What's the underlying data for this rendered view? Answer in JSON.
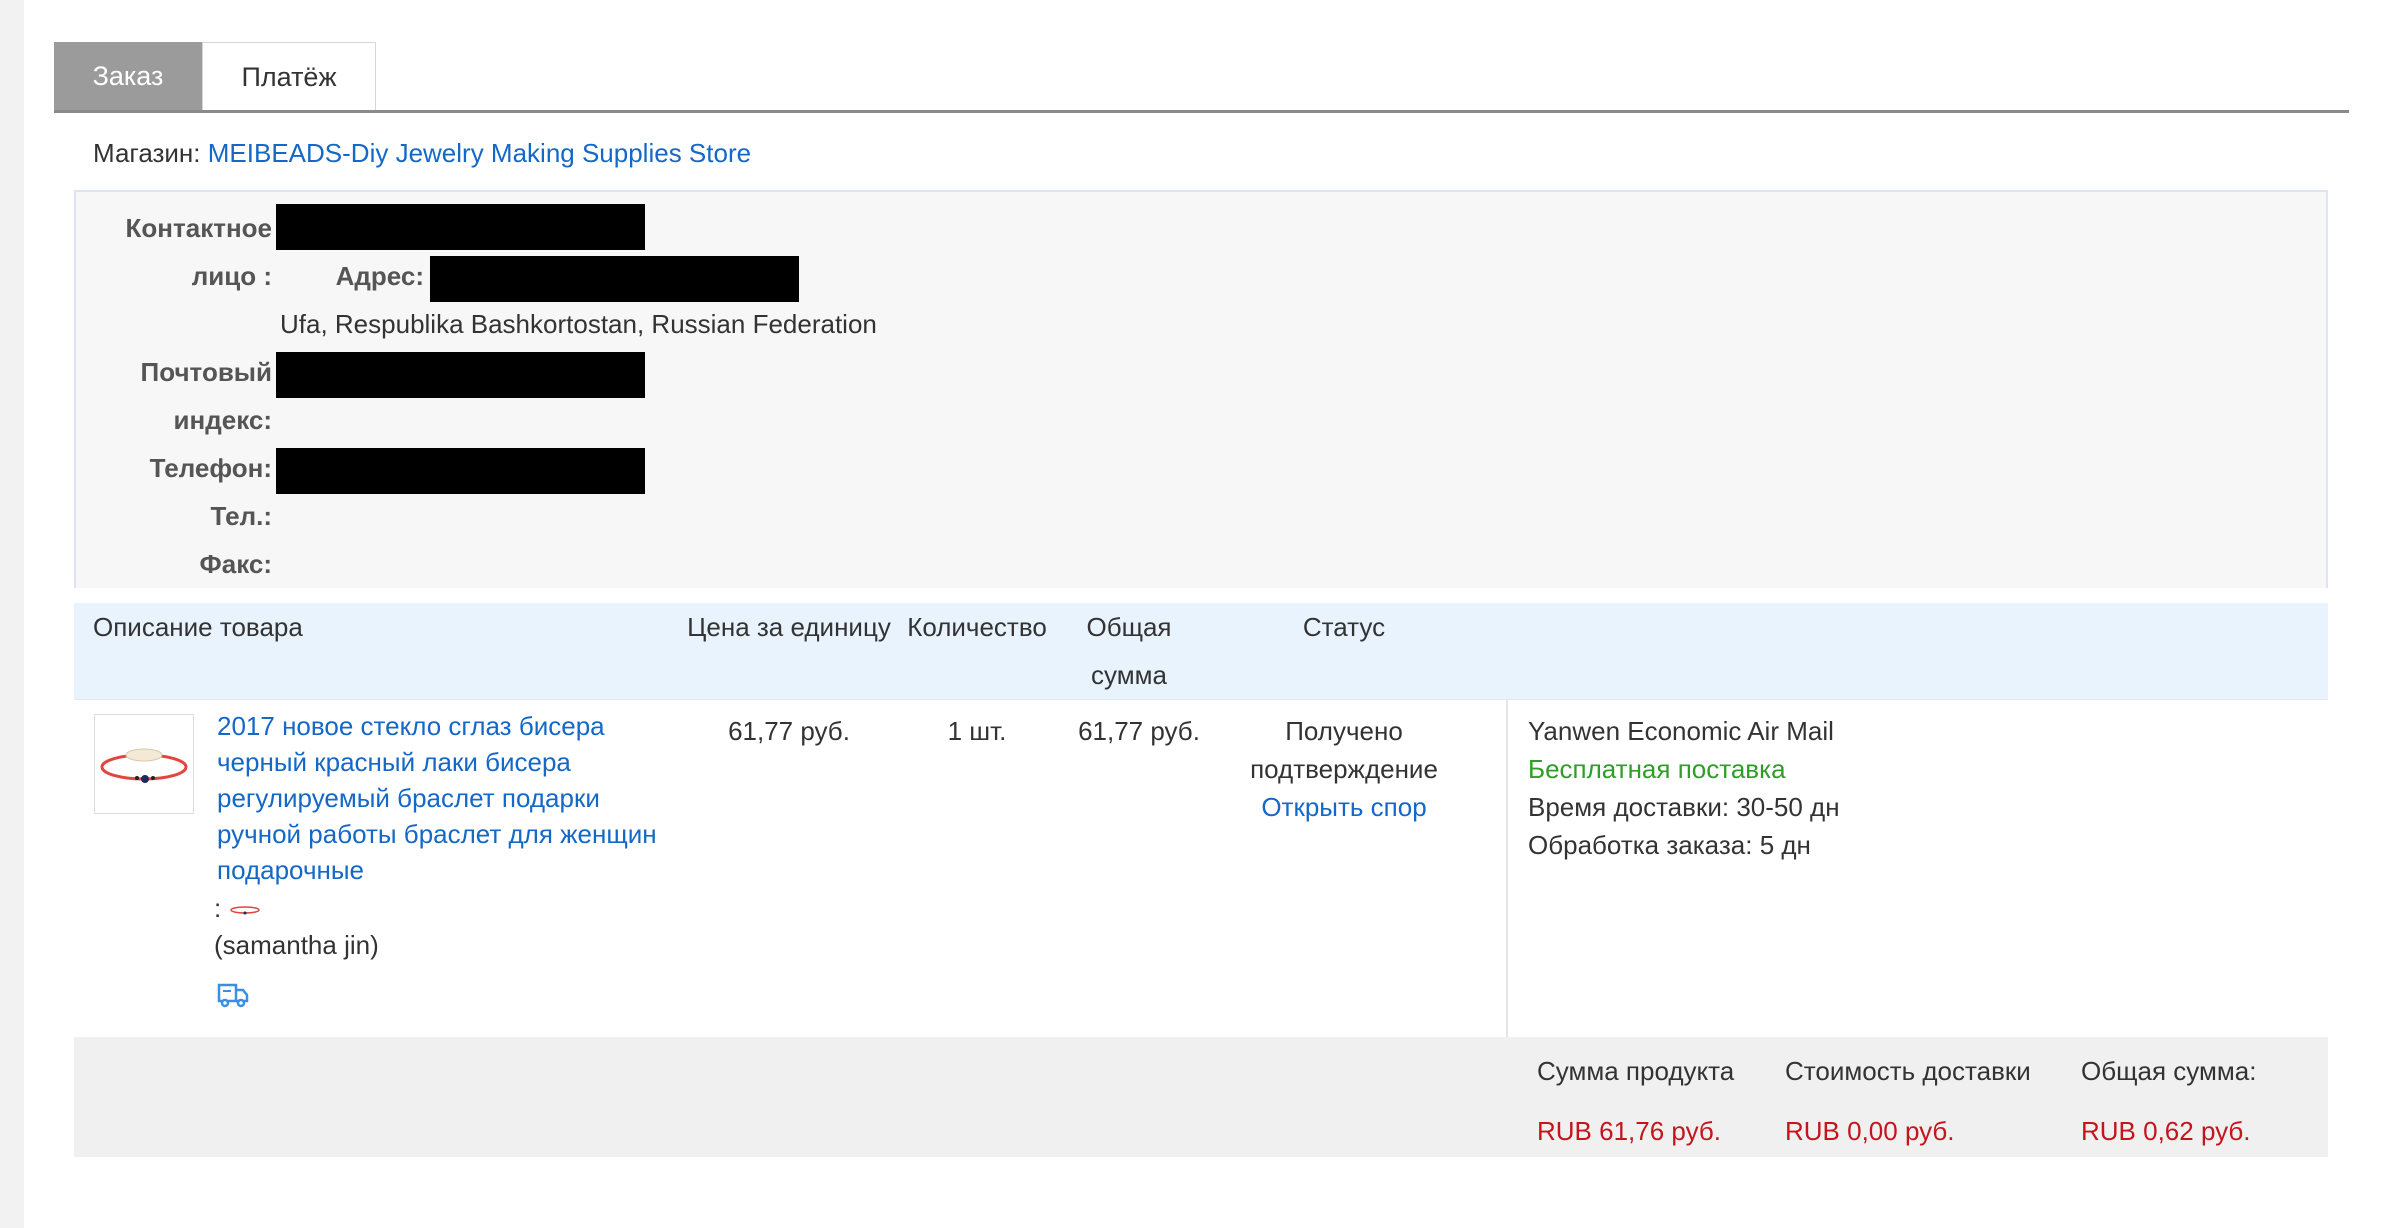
{
  "tabs": {
    "order": "Заказ",
    "payment": "Платёж"
  },
  "store": {
    "label": "Магазин:",
    "name": "MEIBEADS-Diy Jewelry Making Supplies Store"
  },
  "address": {
    "contact_label_1": "Контактное",
    "contact_label_2": "лицо :",
    "address_label": "Адрес:",
    "city_line": "Ufa, Respublika Bashkortostan, Russian Federation",
    "postal_label_1": "Почтовый",
    "postal_label_2": "индекс:",
    "phone_label": "Телефон:",
    "tel_label": "Тел.:",
    "fax_label": "Факс:"
  },
  "table": {
    "headers": {
      "description": "Описание товара",
      "unit_price": "Цена за единицу",
      "quantity": "Количество",
      "total_1": "Общая",
      "total_2": "сумма",
      "status": "Статус"
    },
    "row": {
      "title": "2017 новое стекло сглаз бисера черный красный лаки бисера регулируемый браслет подарки ручной работы браслет для женщин подарочные",
      "variant_prefix": ":",
      "seller": "(samantha jin)",
      "unit_price": "61,77 руб.",
      "quantity": "1 шт.",
      "total": "61,77 руб.",
      "status_1": "Получено",
      "status_2": "подтверждение",
      "dispute_link": "Открыть спор",
      "shipping_method": "Yanwen Economic Air Mail",
      "free_shipping": "Бесплатная поставка",
      "delivery_time_label": "Время доставки:",
      "delivery_time": "30-50 дн",
      "processing_label": "Обработка заказа:",
      "processing_time": "5 дн"
    }
  },
  "totals": {
    "product_sum_label": "Сумма продукта",
    "shipping_cost_label": "Стоимость доставки",
    "grand_total_label": "Общая сумма:",
    "product_sum": "RUB 61,76 руб.",
    "shipping_cost": "RUB 0,00 руб.",
    "grand_total": "RUB 0,62 руб."
  },
  "colors": {
    "link": "#1468c8",
    "price": "#c4151c",
    "free_shipping": "#2f9d27",
    "active_tab": "#9b9b9b"
  },
  "icons": {
    "truck": "truck-icon"
  }
}
